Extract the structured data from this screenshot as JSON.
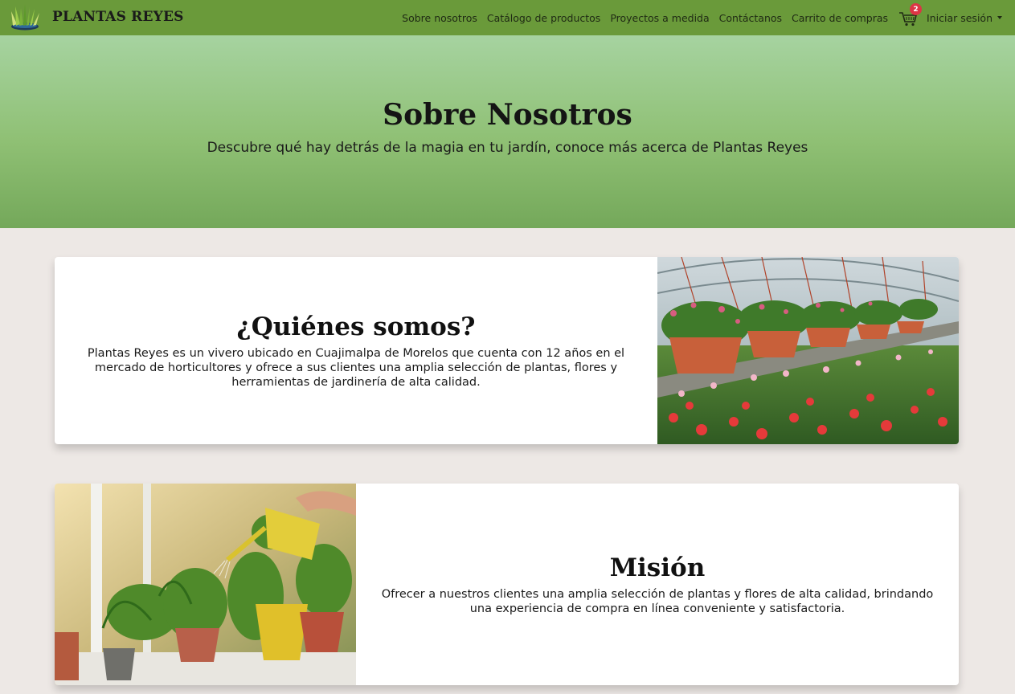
{
  "brand": {
    "name": "PLANTAS REYES",
    "logo_icon": "grass-logo-icon"
  },
  "nav": {
    "links": [
      "Sobre nosotros",
      "Catálogo de productos",
      "Proyectos a medida",
      "Contáctanos",
      "Carrito de compras"
    ],
    "cart_icon": "shopping-cart-icon",
    "cart_count": "2",
    "login_label": "Iniciar sesión"
  },
  "hero": {
    "title": "Sobre Nosotros",
    "subtitle": "Descubre qué hay detrás de la magia en tu jardín, conoce más acerca de Plantas Reyes"
  },
  "sections": [
    {
      "title": "¿Quiénes somos?",
      "body": "Plantas Reyes es un vivero ubicado en Cuajimalpa de Morelos que cuenta con 12 años en el mercado de horticultores y ofrece a sus clientes una amplia selección de plantas, flores y herramientas de jardinería de alta calidad.",
      "image": "greenhouse-hanging-flower-baskets-photo"
    },
    {
      "title": "Misión",
      "body": "Ofrecer a nuestros clientes una amplia selección de plantas y flores de alta calidad, brindando una experiencia de compra en línea conveniente y satisfactoria.",
      "image": "watering-houseplants-window-photo"
    }
  ],
  "colors": {
    "navbar": "#6a9a3a",
    "hero": "#8fc074",
    "page_bg": "#ede8e5",
    "badge": "#dc3545"
  }
}
